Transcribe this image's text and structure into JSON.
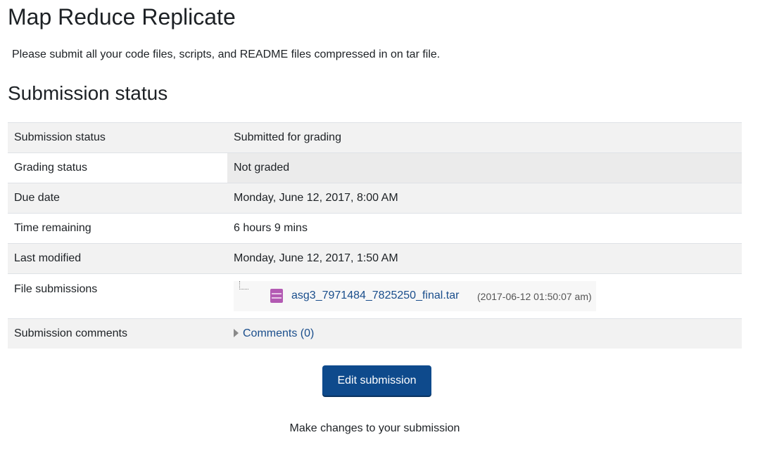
{
  "page": {
    "title": "Map Reduce Replicate",
    "intro": "Please submit all your code files, scripts, and README files compressed in on tar file.",
    "section_title": "Submission status"
  },
  "status_table": {
    "rows": [
      {
        "label": "Submission status",
        "value": "Submitted for grading"
      },
      {
        "label": "Grading status",
        "value": "Not graded"
      },
      {
        "label": "Due date",
        "value": "Monday, June 12, 2017, 8:00 AM"
      },
      {
        "label": "Time remaining",
        "value": "6 hours 9 mins"
      },
      {
        "label": "Last modified",
        "value": "Monday, June 12, 2017, 1:50 AM"
      }
    ],
    "file_submissions": {
      "label": "File submissions",
      "file_name": "asg3_7971484_7825250_final.tar",
      "file_date": "(2017-06-12 01:50:07 am)",
      "file_icon": "archive-file-icon"
    },
    "comments": {
      "label": "Submission comments",
      "link": "Comments (0)"
    }
  },
  "actions": {
    "edit_button": "Edit submission",
    "help_text": "Make changes to your submission"
  },
  "colors": {
    "button": "#0e4a8c",
    "link": "#1a4e8c",
    "file_icon": "#b35ab3"
  }
}
